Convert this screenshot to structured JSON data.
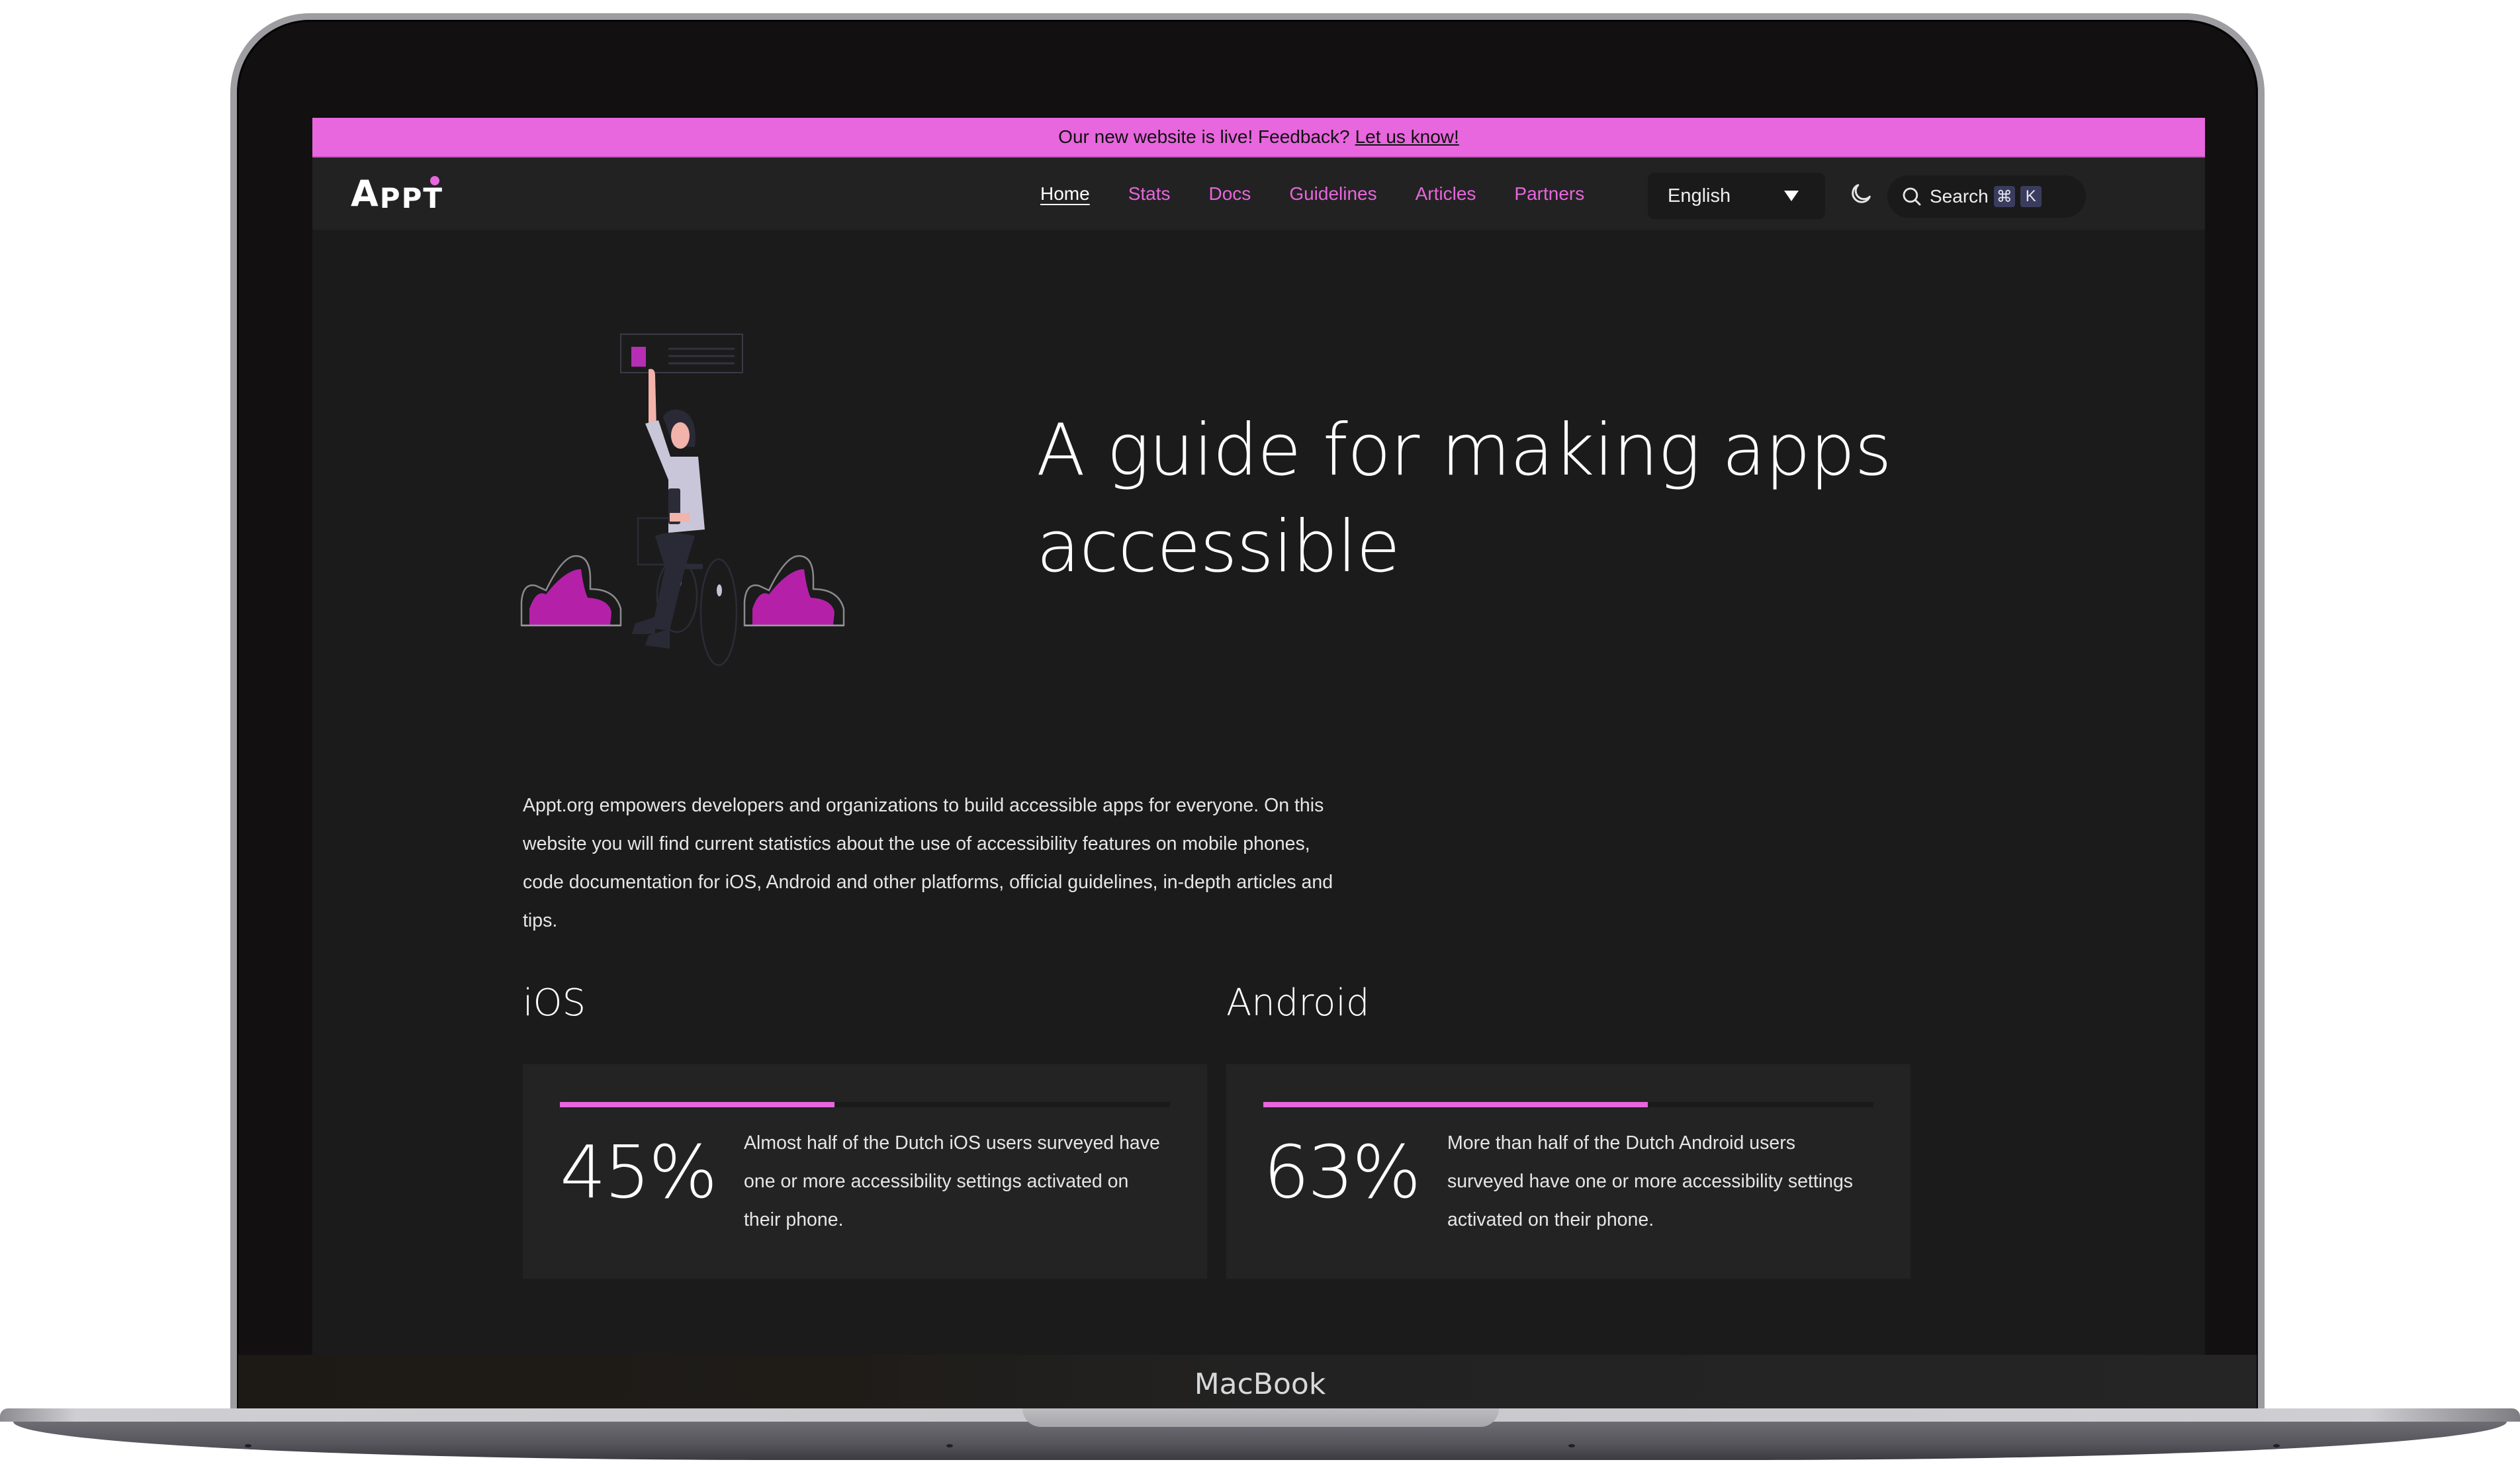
{
  "device": {
    "label": "MacBook"
  },
  "banner": {
    "text": "Our new website is live! Feedback?",
    "link_label": "Let us know!"
  },
  "nav": {
    "logo": {
      "text_big": "A",
      "text_small": "PPT",
      "accent_color": "#E866DE"
    },
    "links": [
      {
        "label": "Home",
        "active": true
      },
      {
        "label": "Stats",
        "active": false
      },
      {
        "label": "Docs",
        "active": false
      },
      {
        "label": "Guidelines",
        "active": false
      },
      {
        "label": "Articles",
        "active": false
      },
      {
        "label": "Partners",
        "active": false
      }
    ],
    "language": {
      "selected": "English",
      "icon": "caret-down-icon"
    },
    "theme_toggle": {
      "icon": "moon-icon"
    },
    "search": {
      "label": "Search",
      "icon": "search-icon",
      "shortcut_keys": [
        "⌘",
        "K"
      ]
    }
  },
  "hero": {
    "title": "A guide for making apps accessible",
    "illustration": "person-in-wheelchair-raising-hand-illustration"
  },
  "intro": {
    "text": "Appt.org empowers developers and organizations to build accessible apps for everyone. On this website you will find current statistics about the use of accessibility features on mobile phones, code documentation for iOS, Android and other platforms, official guidelines, in-depth articles and tips."
  },
  "stats": [
    {
      "platform": "iOS",
      "value": "45%",
      "progress": 0.45,
      "description": "Almost half of the Dutch iOS users surveyed have one or more accessibility settings activated on their phone."
    },
    {
      "platform": "Android",
      "value": "63%",
      "progress": 0.63,
      "description": "More than half of the Dutch Android users surveyed have one or more accessibility settings activated on their phone."
    }
  ],
  "colors": {
    "accent": "#E866DE",
    "background": "#1B1B1B",
    "nav_background": "#222222",
    "card_background": "#232323",
    "keycap": "#3A3C5E"
  }
}
